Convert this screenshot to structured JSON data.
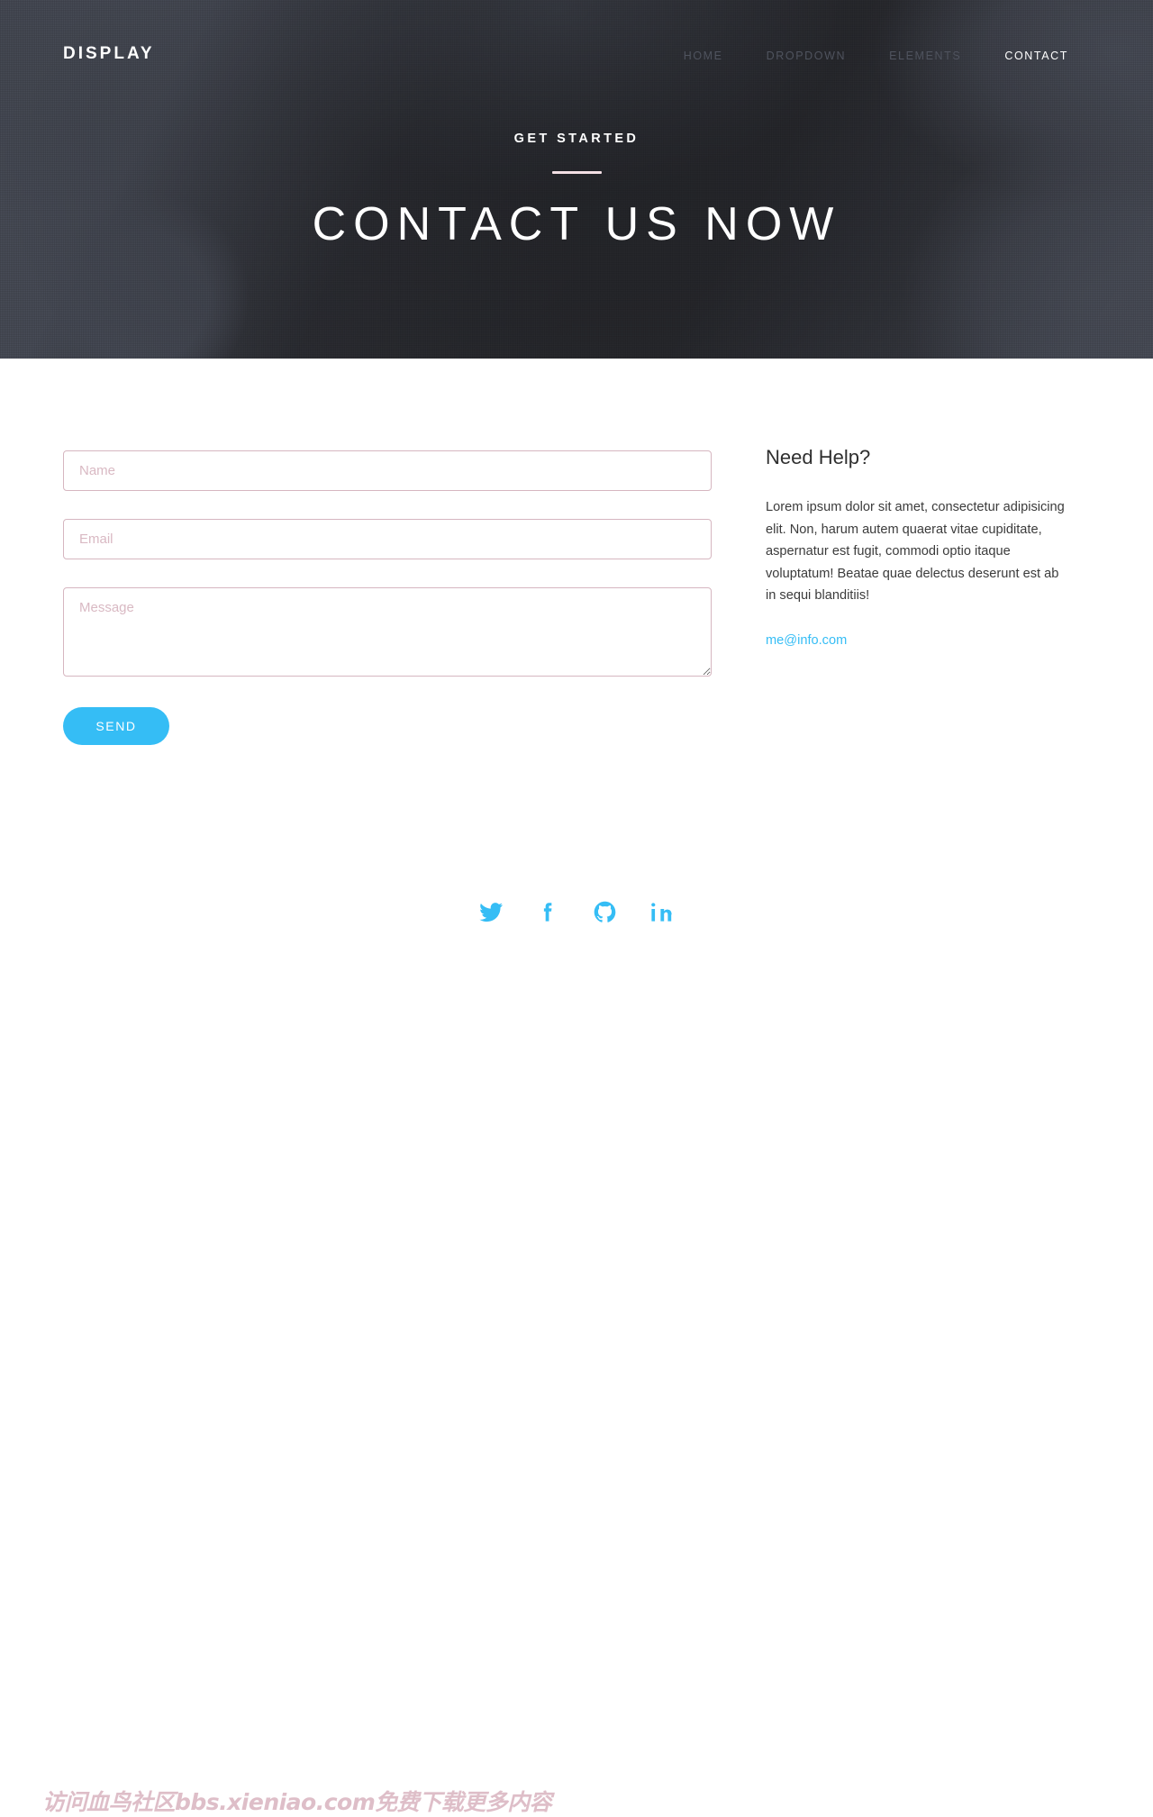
{
  "nav": {
    "brand": "DISPLAY",
    "links": [
      {
        "label": "HOME",
        "active": false
      },
      {
        "label": "DROPDOWN",
        "active": false
      },
      {
        "label": "ELEMENTS",
        "active": false
      },
      {
        "label": "CONTACT",
        "active": true
      }
    ]
  },
  "hero": {
    "eyebrow": "GET STARTED",
    "title": "CONTACT US NOW"
  },
  "form": {
    "name_placeholder": "Name",
    "name_value": "",
    "email_placeholder": "Email",
    "email_value": "",
    "message_placeholder": "Message",
    "message_value": "",
    "send_label": "SEND"
  },
  "sidebar": {
    "title": "Need Help?",
    "body": "Lorem ipsum dolor sit amet, consectetur adipisicing elit. Non, harum autem quaerat vitae cupiditate, aspernatur est fugit, commodi optio itaque voluptatum! Beatae quae delectus deserunt est ab in sequi blanditiis!",
    "email": "me@info.com"
  },
  "footer": {
    "socials": [
      {
        "name": "twitter-icon"
      },
      {
        "name": "facebook-icon"
      },
      {
        "name": "github-icon"
      },
      {
        "name": "linkedin-icon"
      }
    ],
    "watermark": "访问血鸟社区bbs.xieniao.com免费下载更多内容"
  },
  "colors": {
    "accent": "#35bdf5",
    "field_border": "#d6b6c0",
    "placeholder": "#d9b9c3",
    "hero_dark": "#2a2b30",
    "hero_light": "#494d58",
    "watermark": "#debec8"
  }
}
